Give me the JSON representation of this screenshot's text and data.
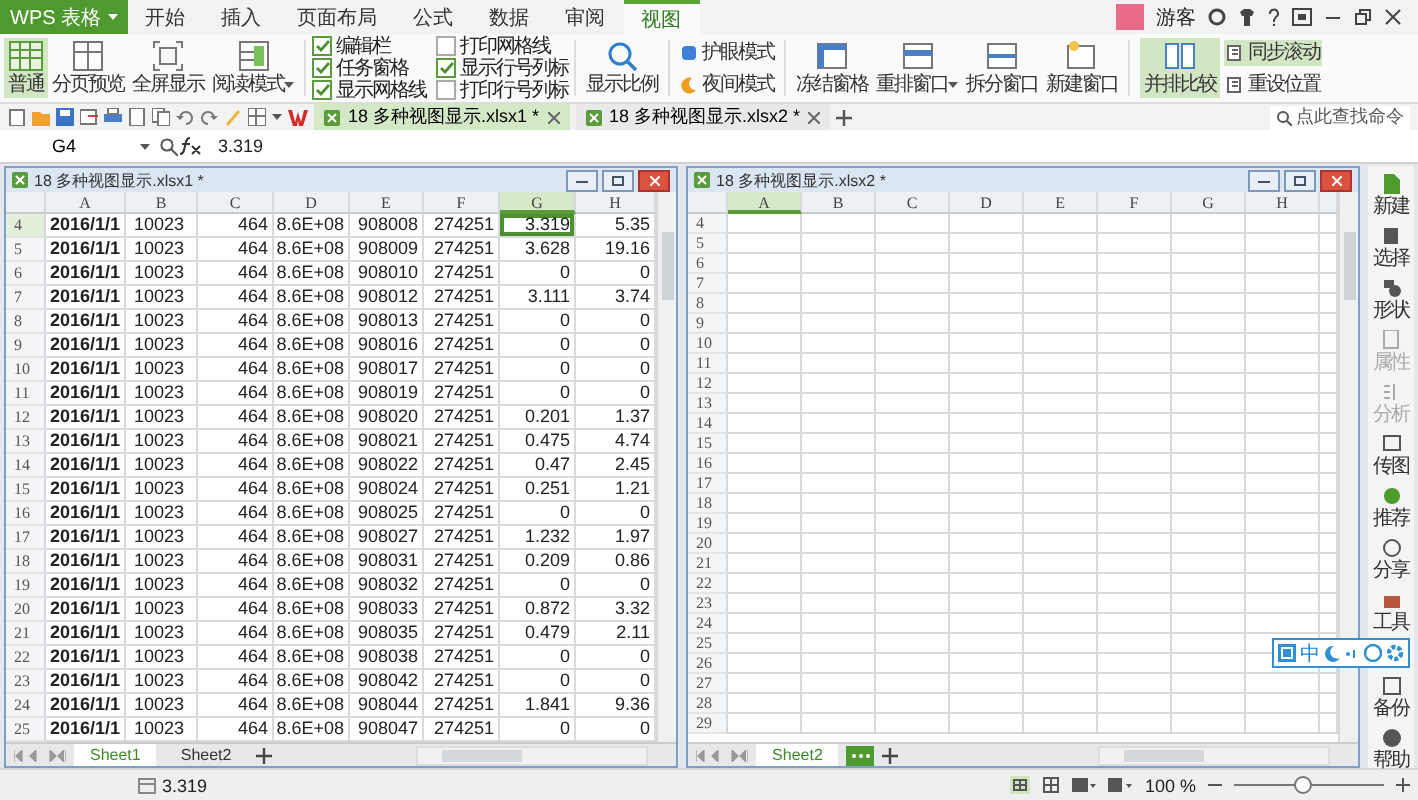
{
  "app": {
    "name": "WPS 表格"
  },
  "menu_tabs": [
    {
      "label": "开始",
      "selected": false
    },
    {
      "label": "插入",
      "selected": false
    },
    {
      "label": "页面布局",
      "selected": false
    },
    {
      "label": "公式",
      "selected": false
    },
    {
      "label": "数据",
      "selected": false
    },
    {
      "label": "审阅",
      "selected": false
    },
    {
      "label": "视图",
      "selected": true
    }
  ],
  "user": {
    "name": "游客"
  },
  "ribbon": {
    "view_buttons": [
      {
        "label": "普通",
        "selected": true,
        "has_menu": false
      },
      {
        "label": "分页预览",
        "selected": false,
        "has_menu": false
      },
      {
        "label": "全屏显示",
        "selected": false,
        "has_menu": false
      },
      {
        "label": "阅读模式",
        "selected": false,
        "has_menu": true
      }
    ],
    "checkboxes": [
      {
        "label": "编辑栏",
        "checked": true
      },
      {
        "label": "任务窗格",
        "checked": true
      },
      {
        "label": "显示网格线",
        "checked": true
      },
      {
        "label": "打印网格线",
        "checked": false
      },
      {
        "label": "显示行号列标",
        "checked": true
      },
      {
        "label": "打印行号列标",
        "checked": false
      }
    ],
    "zoom_button": "显示比例",
    "modes": [
      {
        "label": "护眼模式"
      },
      {
        "label": "夜间模式"
      }
    ],
    "window_buttons": [
      {
        "label": "冻结窗格",
        "has_menu": false
      },
      {
        "label": "重排窗口",
        "has_menu": true
      },
      {
        "label": "拆分窗口",
        "has_menu": false
      },
      {
        "label": "新建窗口",
        "has_menu": false
      }
    ],
    "compare": {
      "label": "并排比较",
      "selected": true
    },
    "sync_items": [
      {
        "label": "同步滚动",
        "selected": true
      },
      {
        "label": "重设位置",
        "selected": false
      }
    ]
  },
  "document_tabs": [
    {
      "title": "18 多种视图显示.xlsx1 *",
      "selected": true
    },
    {
      "title": "18 多种视图显示.xlsx2 *",
      "selected": false
    }
  ],
  "command_search": {
    "placeholder": "点此查找命令"
  },
  "formula_bar": {
    "name_box": "G4",
    "formula": "3.319"
  },
  "windows": [
    {
      "title": "18 多种视图显示.xlsx1 *",
      "more_button": false,
      "columns": [
        {
          "label": "A",
          "selected": false
        },
        {
          "label": "B",
          "selected": false
        },
        {
          "label": "C",
          "selected": false
        },
        {
          "label": "D",
          "selected": false
        },
        {
          "label": "E",
          "selected": false
        },
        {
          "label": "F",
          "selected": false
        },
        {
          "label": "G",
          "selected": true
        },
        {
          "label": "H",
          "selected": false
        }
      ],
      "rows": [
        {
          "header": "4",
          "selected": true,
          "cells": [
            "2016/1/1",
            "10023",
            "464",
            "8.6E+08",
            "908008",
            "274251",
            "3.319",
            "5.35"
          ]
        },
        {
          "header": "5",
          "selected": false,
          "cells": [
            "2016/1/1",
            "10023",
            "464",
            "8.6E+08",
            "908009",
            "274251",
            "3.628",
            "19.16"
          ]
        },
        {
          "header": "6",
          "selected": false,
          "cells": [
            "2016/1/1",
            "10023",
            "464",
            "8.6E+08",
            "908010",
            "274251",
            "0",
            "0"
          ]
        },
        {
          "header": "7",
          "selected": false,
          "cells": [
            "2016/1/1",
            "10023",
            "464",
            "8.6E+08",
            "908012",
            "274251",
            "3.111",
            "3.74"
          ]
        },
        {
          "header": "8",
          "selected": false,
          "cells": [
            "2016/1/1",
            "10023",
            "464",
            "8.6E+08",
            "908013",
            "274251",
            "0",
            "0"
          ]
        },
        {
          "header": "9",
          "selected": false,
          "cells": [
            "2016/1/1",
            "10023",
            "464",
            "8.6E+08",
            "908016",
            "274251",
            "0",
            "0"
          ]
        },
        {
          "header": "10",
          "selected": false,
          "cells": [
            "2016/1/1",
            "10023",
            "464",
            "8.6E+08",
            "908017",
            "274251",
            "0",
            "0"
          ]
        },
        {
          "header": "11",
          "selected": false,
          "cells": [
            "2016/1/1",
            "10023",
            "464",
            "8.6E+08",
            "908019",
            "274251",
            "0",
            "0"
          ]
        },
        {
          "header": "12",
          "selected": false,
          "cells": [
            "2016/1/1",
            "10023",
            "464",
            "8.6E+08",
            "908020",
            "274251",
            "0.201",
            "1.37"
          ]
        },
        {
          "header": "13",
          "selected": false,
          "cells": [
            "2016/1/1",
            "10023",
            "464",
            "8.6E+08",
            "908021",
            "274251",
            "0.475",
            "4.74"
          ]
        },
        {
          "header": "14",
          "selected": false,
          "cells": [
            "2016/1/1",
            "10023",
            "464",
            "8.6E+08",
            "908022",
            "274251",
            "0.47",
            "2.45"
          ]
        },
        {
          "header": "15",
          "selected": false,
          "cells": [
            "2016/1/1",
            "10023",
            "464",
            "8.6E+08",
            "908024",
            "274251",
            "0.251",
            "1.21"
          ]
        },
        {
          "header": "16",
          "selected": false,
          "cells": [
            "2016/1/1",
            "10023",
            "464",
            "8.6E+08",
            "908025",
            "274251",
            "0",
            "0"
          ]
        },
        {
          "header": "17",
          "selected": false,
          "cells": [
            "2016/1/1",
            "10023",
            "464",
            "8.6E+08",
            "908027",
            "274251",
            "1.232",
            "1.97"
          ]
        },
        {
          "header": "18",
          "selected": false,
          "cells": [
            "2016/1/1",
            "10023",
            "464",
            "8.6E+08",
            "908031",
            "274251",
            "0.209",
            "0.86"
          ]
        },
        {
          "header": "19",
          "selected": false,
          "cells": [
            "2016/1/1",
            "10023",
            "464",
            "8.6E+08",
            "908032",
            "274251",
            "0",
            "0"
          ]
        },
        {
          "header": "20",
          "selected": false,
          "cells": [
            "2016/1/1",
            "10023",
            "464",
            "8.6E+08",
            "908033",
            "274251",
            "0.872",
            "3.32"
          ]
        },
        {
          "header": "21",
          "selected": false,
          "cells": [
            "2016/1/1",
            "10023",
            "464",
            "8.6E+08",
            "908035",
            "274251",
            "0.479",
            "2.11"
          ]
        },
        {
          "header": "22",
          "selected": false,
          "cells": [
            "2016/1/1",
            "10023",
            "464",
            "8.6E+08",
            "908038",
            "274251",
            "0",
            "0"
          ]
        },
        {
          "header": "23",
          "selected": false,
          "cells": [
            "2016/1/1",
            "10023",
            "464",
            "8.6E+08",
            "908042",
            "274251",
            "0",
            "0"
          ]
        },
        {
          "header": "24",
          "selected": false,
          "cells": [
            "2016/1/1",
            "10023",
            "464",
            "8.6E+08",
            "908044",
            "274251",
            "1.841",
            "9.36"
          ]
        },
        {
          "header": "25",
          "selected": false,
          "cells": [
            "2016/1/1",
            "10023",
            "464",
            "8.6E+08",
            "908047",
            "274251",
            "0",
            "0"
          ]
        }
      ],
      "sheet_tabs": [
        {
          "label": "Sheet1",
          "selected": true
        },
        {
          "label": "Sheet2",
          "selected": false
        }
      ]
    },
    {
      "title": "18 多种视图显示.xlsx2 *",
      "more_button": true,
      "columns": [
        {
          "label": "A",
          "selected": true
        },
        {
          "label": "B",
          "selected": false
        },
        {
          "label": "C",
          "selected": false
        },
        {
          "label": "D",
          "selected": false
        },
        {
          "label": "E",
          "selected": false
        },
        {
          "label": "F",
          "selected": false
        },
        {
          "label": "G",
          "selected": false
        },
        {
          "label": "H",
          "selected": false
        }
      ],
      "rows": [
        {
          "header": "4",
          "selected": false
        },
        {
          "header": "5",
          "selected": false
        },
        {
          "header": "6",
          "selected": false
        },
        {
          "header": "7",
          "selected": false
        },
        {
          "header": "8",
          "selected": false
        },
        {
          "header": "9",
          "selected": false
        },
        {
          "header": "10",
          "selected": false
        },
        {
          "header": "11",
          "selected": false
        },
        {
          "header": "12",
          "selected": false
        },
        {
          "header": "13",
          "selected": false
        },
        {
          "header": "14",
          "selected": false
        },
        {
          "header": "15",
          "selected": false
        },
        {
          "header": "16",
          "selected": false
        },
        {
          "header": "17",
          "selected": false
        },
        {
          "header": "18",
          "selected": false
        },
        {
          "header": "19",
          "selected": false
        },
        {
          "header": "20",
          "selected": false
        },
        {
          "header": "21",
          "selected": false
        },
        {
          "header": "22",
          "selected": false
        },
        {
          "header": "23",
          "selected": false
        },
        {
          "header": "24",
          "selected": false
        },
        {
          "header": "25",
          "selected": false
        },
        {
          "header": "26",
          "selected": false
        },
        {
          "header": "27",
          "selected": false
        },
        {
          "header": "28",
          "selected": false
        },
        {
          "header": "29",
          "selected": false
        }
      ],
      "sheet_tabs": [
        {
          "label": "Sheet2",
          "selected": true
        }
      ]
    }
  ],
  "sidebar": [
    {
      "label": "新建",
      "disabled": false
    },
    {
      "label": "选择",
      "disabled": false
    },
    {
      "label": "形状",
      "disabled": false
    },
    {
      "label": "属性",
      "disabled": true
    },
    {
      "label": "分析",
      "disabled": true
    },
    {
      "label": "传图",
      "disabled": false
    },
    {
      "label": "推荐",
      "disabled": false
    },
    {
      "label": "分享",
      "disabled": false
    },
    {
      "label": "工具",
      "disabled": false
    },
    {
      "label": "备份",
      "disabled": false
    },
    {
      "label": "帮助",
      "disabled": false
    }
  ],
  "ime_bar": {
    "mode": "中"
  },
  "status_bar": {
    "value": "3.319",
    "zoom": "100 %",
    "zoom_slider": {
      "level": 0.45
    }
  }
}
